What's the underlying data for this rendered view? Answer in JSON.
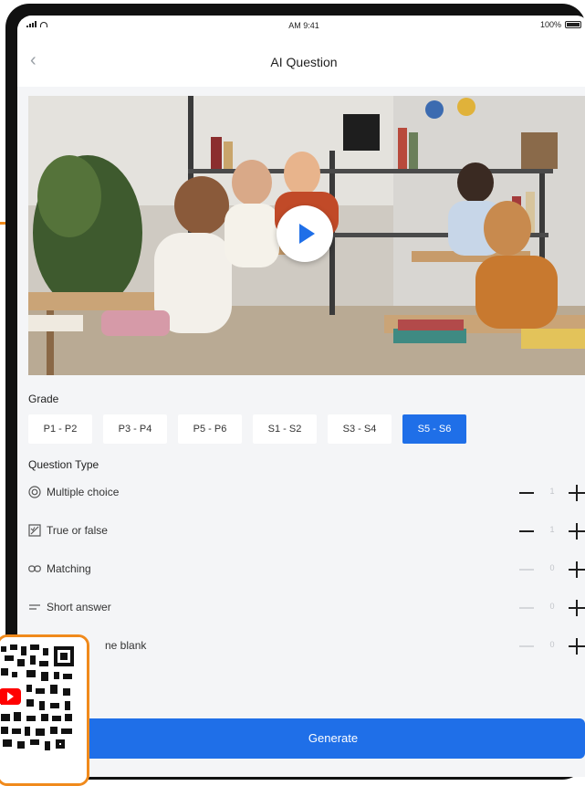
{
  "status_bar": {
    "time": "AM 9:41",
    "battery": "100%"
  },
  "nav": {
    "back_glyph": "‹",
    "title": "AI Question"
  },
  "video": {
    "play_icon": "play-icon"
  },
  "grade": {
    "label": "Grade",
    "options": [
      "P1 - P2",
      "P3 - P4",
      "P5 - P6",
      "S1 - S2",
      "S3 - S4",
      "S5 - S6"
    ],
    "selected": "S5 - S6"
  },
  "question_type": {
    "label": "Question Type",
    "items": [
      {
        "label": "Multiple choice",
        "icon": "radio-circle-icon",
        "count": "1"
      },
      {
        "label": "True or false",
        "icon": "true-false-icon",
        "count": "1"
      },
      {
        "label": "Matching",
        "icon": "link-icon",
        "count": "0"
      },
      {
        "label": "Short answer",
        "icon": "lines-icon",
        "count": "0"
      },
      {
        "label": "ne blank",
        "icon": "blank-icon",
        "count": "0"
      }
    ]
  },
  "generate_label": "Generate",
  "colors": {
    "accent": "#1f6fe8",
    "overlay_border": "#f08a1c",
    "youtube_red": "#ff0000"
  }
}
